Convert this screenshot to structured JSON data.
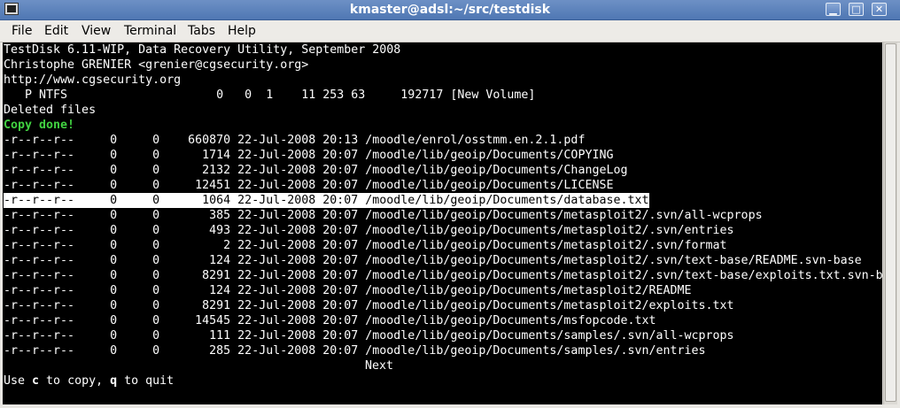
{
  "window": {
    "title": "kmaster@adsl:~/src/testdisk",
    "buttons": {
      "minimize": "▁",
      "maximize": "□",
      "close": "✕"
    }
  },
  "menu": [
    "File",
    "Edit",
    "View",
    "Terminal",
    "Tabs",
    "Help"
  ],
  "terminal": {
    "header": [
      "TestDisk 6.11-WIP, Data Recovery Utility, September 2008",
      "Christophe GRENIER <grenier@cgsecurity.org>",
      "http://www.cgsecurity.org",
      "   P NTFS                     0   0  1    11 253 63     192717 [New Volume]",
      "Deleted files"
    ],
    "status": "Copy done!",
    "files": [
      "-r--r--r--     0     0    660870 22-Jul-2008 20:13 /moodle/enrol/osstmm.en.2.1.pdf",
      "-r--r--r--     0     0      1714 22-Jul-2008 20:07 /moodle/lib/geoip/Documents/COPYING",
      "-r--r--r--     0     0      2132 22-Jul-2008 20:07 /moodle/lib/geoip/Documents/ChangeLog",
      "-r--r--r--     0     0     12451 22-Jul-2008 20:07 /moodle/lib/geoip/Documents/LICENSE",
      "-r--r--r--     0     0      1064 22-Jul-2008 20:07 /moodle/lib/geoip/Documents/database.txt",
      "-r--r--r--     0     0       385 22-Jul-2008 20:07 /moodle/lib/geoip/Documents/metasploit2/.svn/all-wcprops",
      "-r--r--r--     0     0       493 22-Jul-2008 20:07 /moodle/lib/geoip/Documents/metasploit2/.svn/entries",
      "-r--r--r--     0     0         2 22-Jul-2008 20:07 /moodle/lib/geoip/Documents/metasploit2/.svn/format",
      "-r--r--r--     0     0       124 22-Jul-2008 20:07 /moodle/lib/geoip/Documents/metasploit2/.svn/text-base/README.svn-base",
      "-r--r--r--     0     0      8291 22-Jul-2008 20:07 /moodle/lib/geoip/Documents/metasploit2/.svn/text-base/exploits.txt.svn-b",
      "-r--r--r--     0     0       124 22-Jul-2008 20:07 /moodle/lib/geoip/Documents/metasploit2/README",
      "-r--r--r--     0     0      8291 22-Jul-2008 20:07 /moodle/lib/geoip/Documents/metasploit2/exploits.txt",
      "-r--r--r--     0     0     14545 22-Jul-2008 20:07 /moodle/lib/geoip/Documents/msfopcode.txt",
      "-r--r--r--     0     0       111 22-Jul-2008 20:07 /moodle/lib/geoip/Documents/samples/.svn/all-wcprops",
      "-r--r--r--     0     0       285 22-Jul-2008 20:07 /moodle/lib/geoip/Documents/samples/.svn/entries"
    ],
    "selected_index": 4,
    "next_label": "Next",
    "footer": {
      "use": "Use ",
      "key_copy": "c",
      "to_copy": " to copy, ",
      "key_quit": "q",
      "to_quit": " to quit"
    }
  }
}
